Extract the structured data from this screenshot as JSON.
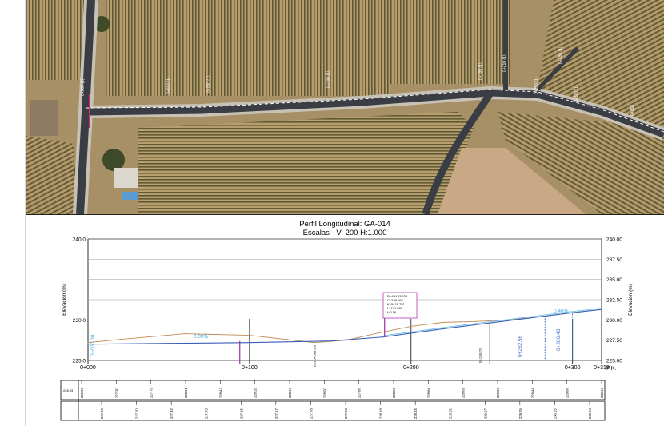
{
  "profile": {
    "title": "Perfil Longitudinal: GA-014",
    "subtitle": "Escalas - V: 200 H:1.000",
    "ylabel_left": "Elevación (m)",
    "ylabel_right": "Elevación (m)",
    "px_label": "P.K.",
    "gradient_labels": [
      "0.09%",
      "0.46%"
    ],
    "curve_info": [
      "PI=0+183.632",
      "C=229.068",
      "K=5418.751",
      "L=101.581",
      "f=0.56"
    ],
    "stations_left": [
      "0+000.00",
      "228.93"
    ],
    "vertical_labels": [
      "0+282.96",
      "0+286.43",
      "Km 0+093.99",
      "0+183.63",
      "0+248.79"
    ],
    "colors": {
      "terrain": "#c08a57",
      "grade": "#3a5fb8",
      "grade_light": "#69c3e6",
      "marker": "#9a2fa8"
    }
  },
  "aerial": {
    "labels": [
      "0+000 (1)",
      "0+030 (1)",
      "0+060 (1)",
      "0+100 (1)",
      "0+180 (1)",
      "0+210 (1)",
      "0+250 (1)",
      "0+280 (1)",
      "0+300 (1)",
      "0+318"
    ]
  },
  "chart_data": {
    "type": "line",
    "title": "Perfil Longitudinal: GA-014",
    "subtitle": "Escalas - V: 200 H:1.000",
    "ylabel": "Elevación (m)",
    "xlabel": "P.K.",
    "ylim": [
      225.0,
      240.0
    ],
    "xlim": [
      0,
      318
    ],
    "y_ticks": [
      "225.00",
      "227.50",
      "230.00",
      "232.50",
      "235.00",
      "237.50",
      "240.00"
    ],
    "y_ticks_left": [
      "225.0",
      "230.0",
      "240.0"
    ],
    "x_ticks": [
      "0+000",
      "0+100",
      "0+200",
      "0+300",
      "0+318"
    ],
    "series": [
      {
        "x": [
          0,
          20,
          60,
          100,
          140,
          160,
          180,
          200,
          220,
          240,
          260,
          280,
          300,
          318
        ],
        "y": [
          227.2,
          227.6,
          228.3,
          228.1,
          227.2,
          227.5,
          228.4,
          229.2,
          229.7,
          229.8,
          230.0,
          230.4,
          230.9,
          231.3
        ]
      },
      {
        "x": [
          0,
          50,
          100,
          150,
          183,
          220,
          260,
          300,
          318
        ],
        "y": [
          227.0,
          227.1,
          227.2,
          227.4,
          227.9,
          228.9,
          229.9,
          230.9,
          231.3
        ]
      }
    ],
    "table_row1": [
      "226.96",
      "227.30",
      "227.79",
      "228.21",
      "228.42",
      "228.28",
      "228.14",
      "228.00",
      "227.86",
      "228.53",
      "228.84",
      "228.91",
      "229.06",
      "229.44",
      "229.96",
      "230.14"
    ],
    "table_row2": [
      "227.00",
      "227.20",
      "227.32",
      "227.43",
      "227.55",
      "227.67",
      "227.78",
      "227.93",
      "228.18",
      "228.45",
      "228.82",
      "229.27",
      "229.76",
      "230.25",
      "230.74"
    ]
  }
}
